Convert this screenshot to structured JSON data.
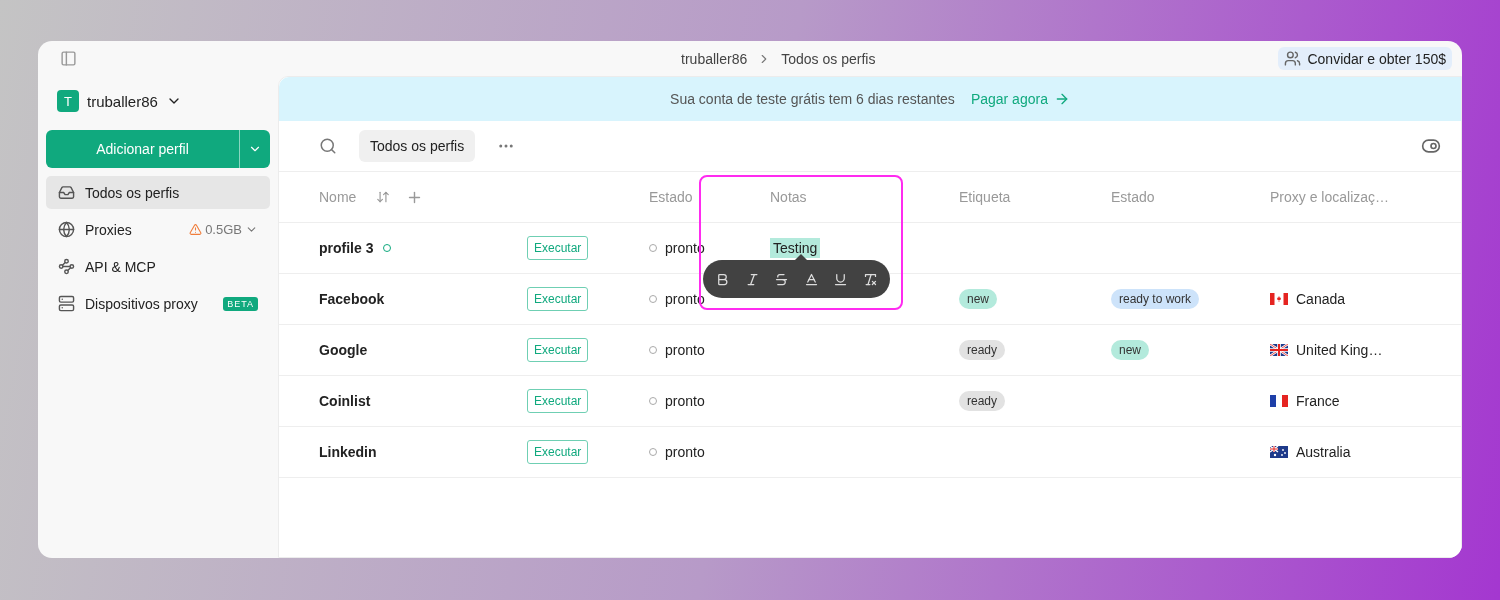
{
  "breadcrumb": [
    "truballer86",
    "Todos os perfis"
  ],
  "invite": {
    "label": "Convidar e obter 150$"
  },
  "workspace": {
    "initial": "T",
    "name": "truballer86"
  },
  "add_button": {
    "label": "Adicionar perfil"
  },
  "sidebar": {
    "items": [
      {
        "kind": "inbox",
        "label": "Todos os perfis",
        "selected": true
      },
      {
        "kind": "globe",
        "label": "Proxies",
        "selected": false,
        "usage": "0.5GB"
      },
      {
        "kind": "api",
        "label": "API & MCP",
        "selected": false
      },
      {
        "kind": "server",
        "label": "Dispositivos proxy",
        "selected": false,
        "badge": "BETA"
      }
    ]
  },
  "banner": {
    "text": "Sua conta de teste grátis tem 6 dias restantes",
    "link": "Pagar agora"
  },
  "toolbar": {
    "filter": "Todos os perfis"
  },
  "table": {
    "columns": [
      "Nome",
      "",
      "Estado",
      "Notas",
      "Etiqueta",
      "Estado",
      "Proxy e localizaç…"
    ],
    "rows": [
      {
        "name": "profile 3",
        "active": true,
        "run": "Executar",
        "status": "pronto",
        "note": "Testing",
        "tag": null,
        "state": null,
        "proxy": null
      },
      {
        "name": "Facebook",
        "active": false,
        "run": "Executar",
        "status": "pronto",
        "note": null,
        "tag": {
          "label": "new",
          "color": "#b3eadc"
        },
        "state": {
          "label": "ready to work",
          "color": "#cde3fa"
        },
        "proxy": {
          "kind": "ca",
          "label": "Canada"
        }
      },
      {
        "name": "Google",
        "active": false,
        "run": "Executar",
        "status": "pronto",
        "note": null,
        "tag": {
          "label": "ready",
          "color": "#e2e2e2"
        },
        "state": {
          "label": "new",
          "color": "#b3eadc"
        },
        "proxy": {
          "kind": "gb",
          "label": "United King…"
        }
      },
      {
        "name": "Coinlist",
        "active": false,
        "run": "Executar",
        "status": "pronto",
        "note": null,
        "tag": {
          "label": "ready",
          "color": "#e2e2e2"
        },
        "state": null,
        "proxy": {
          "kind": "fr",
          "label": "France"
        }
      },
      {
        "name": "Linkedin",
        "active": false,
        "run": "Executar",
        "status": "pronto",
        "note": null,
        "tag": null,
        "state": null,
        "proxy": {
          "kind": "au",
          "label": "Australia"
        }
      }
    ]
  },
  "format_toolbar": {
    "tools": [
      {
        "kind": "bold"
      },
      {
        "kind": "italic"
      },
      {
        "kind": "strike"
      },
      {
        "kind": "highlight"
      },
      {
        "kind": "underline"
      },
      {
        "kind": "clear"
      }
    ]
  }
}
